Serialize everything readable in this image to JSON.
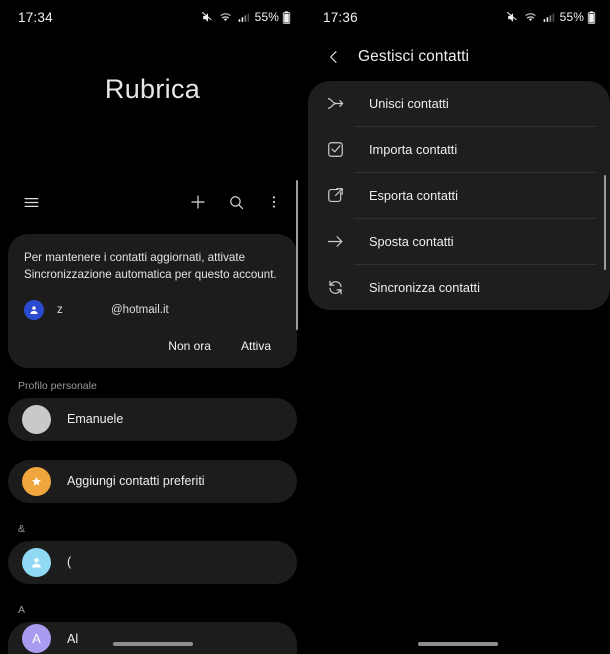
{
  "left": {
    "status": {
      "time": "17:34",
      "battery": "55%",
      "icons": [
        "mute-icon",
        "wifi-icon",
        "signal-icon",
        "battery-icon"
      ]
    },
    "title": "Rubrica",
    "toolbar": {
      "menu": "hamburger-menu-icon",
      "add": "plus-icon",
      "search": "search-icon",
      "more": "overflow-menu-icon"
    },
    "banner": {
      "line1": "Per mantenere i contatti aggiornati, attivate",
      "line2": "Sincronizzazione automatica per questo account.",
      "account_name": "z",
      "account_mail": "@hotmail.it",
      "btn_dismiss": "Non ora",
      "btn_confirm": "Attiva"
    },
    "sections": [
      {
        "label": "Profilo personale",
        "items": [
          {
            "name": "Emanuele",
            "avatar_color": "#c9c9c9",
            "avatar_text": ""
          }
        ]
      },
      {
        "label": "",
        "items": [
          {
            "name": "Aggiungi contatti preferiti",
            "avatar_color": "#f0a63c",
            "avatar_text": "★"
          }
        ]
      },
      {
        "label": "&",
        "items": [
          {
            "name": "(",
            "avatar_color": "#8fd9f5",
            "avatar_text": ""
          }
        ]
      },
      {
        "label": "A",
        "items": [
          {
            "name": "Al",
            "avatar_color": "#a99bef",
            "avatar_text": "A"
          }
        ]
      }
    ]
  },
  "right": {
    "status": {
      "time": "17:36",
      "battery": "55%"
    },
    "header": {
      "back": "back-chevron-icon",
      "title": "Gestisci contatti"
    },
    "menu_items": [
      {
        "label": "Unisci contatti",
        "icon": "merge-icon"
      },
      {
        "label": "Importa contatti",
        "icon": "import-icon"
      },
      {
        "label": "Esporta contatti",
        "icon": "export-icon"
      },
      {
        "label": "Sposta contatti",
        "icon": "move-arrow-icon"
      },
      {
        "label": "Sincronizza contatti",
        "icon": "sync-icon"
      }
    ]
  },
  "colors": {
    "background": "#000000",
    "card": "#1c1c1c",
    "menu_card": "#1e1e1e",
    "text": "#ededed",
    "muted": "#9a9a9a",
    "accent_blue": "#2a4bd0"
  }
}
